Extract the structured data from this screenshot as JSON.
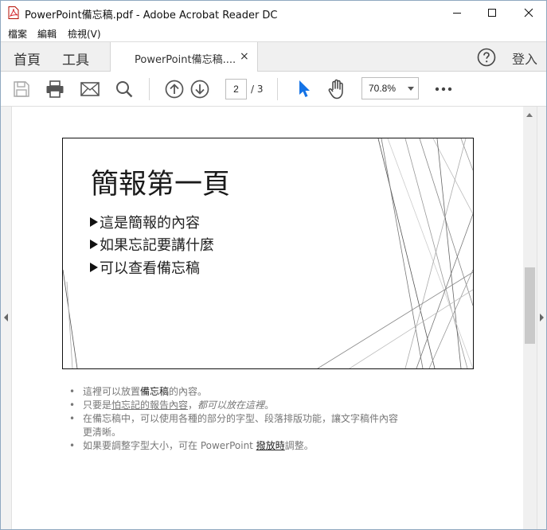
{
  "window": {
    "title": "PowerPoint備忘稿.pdf - Adobe Acrobat Reader DC",
    "icon": "pdf-file-icon"
  },
  "menu": [
    "檔案",
    "編輯",
    "檢視(V)"
  ],
  "tabs": {
    "home": "首頁",
    "tools": "工具",
    "document": "PowerPoint備忘稿....",
    "close": "×",
    "signin": "登入"
  },
  "toolbar": {
    "page_current": "2",
    "page_total": "/ 3",
    "zoom": "70.8%"
  },
  "slide": {
    "title": "簡報第一頁",
    "bullets": [
      "這是簡報的內容",
      "如果忘記要講什麼",
      "可以查看備忘稿"
    ]
  },
  "notes": {
    "n1": {
      "a": "這裡可以放置",
      "b": "備忘稿",
      "c": "的內容。"
    },
    "n2": {
      "a": "只要是",
      "b": "怕忘記的報告內容",
      "c": "，",
      "d": "都可以放在這裡",
      "e": "。"
    },
    "n3": {
      "line1": "在備忘稿中，可以使用各種的部分的字型、段落排版功能，讓文字稿件內容",
      "line2": "更清晰。"
    },
    "n4": {
      "a": "如果要調整字型大小，可在 PowerPoint ",
      "b": "撥放時",
      "c": "調整。"
    }
  },
  "colors": {
    "accent_blue": "#1473e6",
    "icon_gray": "#555555",
    "notes_gray": "#777777"
  }
}
